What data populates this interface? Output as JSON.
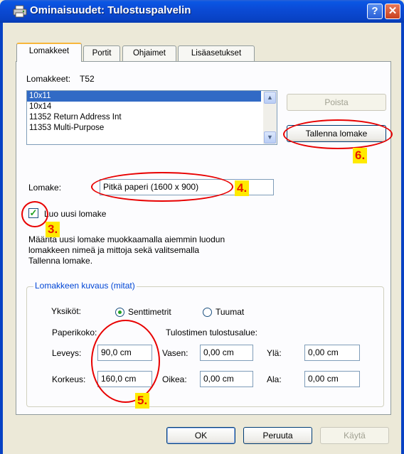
{
  "window": {
    "title": "Ominaisuudet: Tulostuspalvelin"
  },
  "tabs": [
    {
      "label": "Lomakkeet"
    },
    {
      "label": "Portit"
    },
    {
      "label": "Ohjaimet"
    },
    {
      "label": "Lisäasetukset"
    }
  ],
  "forms": {
    "header_label": "Lomakkeet:",
    "server_name": "T52",
    "list": [
      "10x11",
      "10x14",
      "11352 Return Address Int",
      "11353 Multi-Purpose"
    ],
    "selected_index": 0,
    "delete_button": "Poista",
    "save_button": "Tallenna lomake",
    "form_label": "Lomake:",
    "form_name_value": "Pitkä paperi (1600 x 900)",
    "create_new_label": "Luo uusi lomake",
    "create_new_checked": true,
    "description_lines": [
      "Määritä uusi lomake muokkaamalla aiemmin luodun",
      "lomakkeen nimeä ja mittoja sekä valitsemalla",
      "Tallenna lomake."
    ]
  },
  "description_group": {
    "title": "Lomakkeen kuvaus (mitat)",
    "units_label": "Yksiköt:",
    "unit_cm": "Senttimetrit",
    "unit_inch": "Tuumat",
    "selected_unit": "cm",
    "paper_size_label": "Paperikoko:",
    "width_label": "Leveys:",
    "width_value": "90,0 cm",
    "height_label": "Korkeus:",
    "height_value": "160,0 cm",
    "printable_area_label": "Tulostimen tulostusalue:",
    "left_label": "Vasen:",
    "left_value": "0,00 cm",
    "right_label": "Oikea:",
    "right_value": "0,00 cm",
    "top_label": "Ylä:",
    "top_value": "0,00 cm",
    "bottom_label": "Ala:",
    "bottom_value": "0,00 cm"
  },
  "footer": {
    "ok": "OK",
    "cancel": "Peruuta",
    "apply": "Käytä"
  },
  "titlebar_buttons": {
    "help": "?",
    "close": "✕"
  },
  "annotations": {
    "step3": "3.",
    "step4": "4.",
    "step5": "5.",
    "step6": "6."
  },
  "colors": {
    "accent": "#0842c4",
    "annotation_ring": "#e80000",
    "badge_bg": "#ffea00",
    "badge_text": "#e81a00"
  }
}
